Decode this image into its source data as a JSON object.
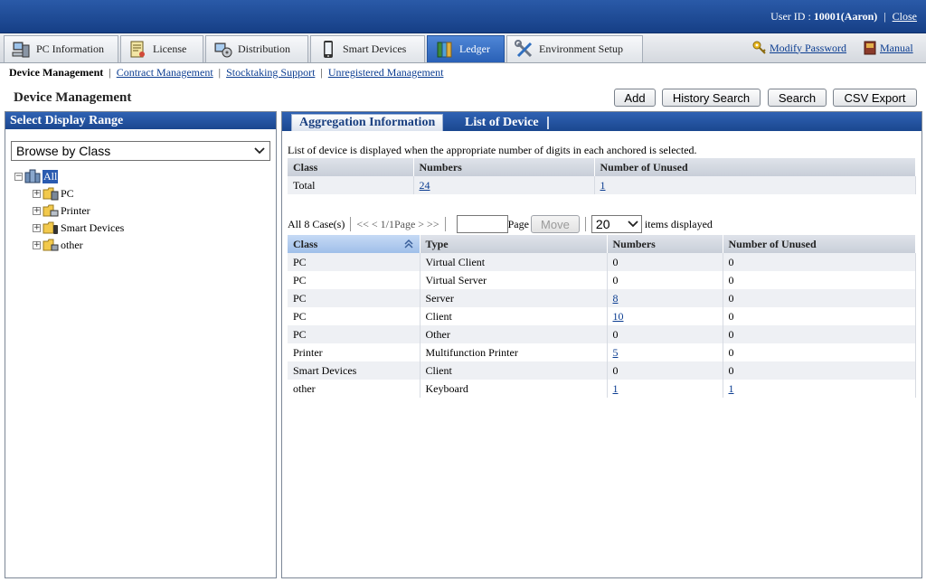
{
  "header": {
    "user_label": "User ID :",
    "user_value": "10001(Aaron)",
    "separator": "|",
    "close_label": "Close"
  },
  "nav": {
    "tabs": [
      {
        "label": "PC Information",
        "icon": "pc-icon"
      },
      {
        "label": "License",
        "icon": "license-icon"
      },
      {
        "label": "Distribution",
        "icon": "distribution-icon"
      },
      {
        "label": "Smart Devices",
        "icon": "smart-device-icon"
      },
      {
        "label": "Ledger",
        "icon": "ledger-icon",
        "active": true
      },
      {
        "label": "Environment Setup",
        "icon": "tools-icon"
      }
    ],
    "modify_password": "Modify Password",
    "manual": "Manual"
  },
  "subnav": {
    "items": [
      "Device Management",
      "Contract Management",
      "Stocktaking Support",
      "Unregistered Management"
    ],
    "separator": "|"
  },
  "page": {
    "title": "Device Management",
    "buttons": {
      "add": "Add",
      "history_search": "History Search",
      "search": "Search",
      "csv_export": "CSV Export"
    }
  },
  "left_panel": {
    "title": "Select Display Range",
    "browse_select": "Browse by Class",
    "tree": {
      "root": "All",
      "children": [
        "PC",
        "Printer",
        "Smart Devices",
        "other"
      ]
    }
  },
  "right_panel": {
    "tabs": [
      "Aggregation Information",
      "List of Device"
    ],
    "description": "List of device is displayed when the appropriate number of digits in each anchored is selected.",
    "summary": {
      "headers": [
        "Class",
        "Numbers",
        "Number of Unused"
      ],
      "row": {
        "class": "Total",
        "numbers": "24",
        "unused": "1"
      }
    },
    "pager": {
      "count": "All 8 Case(s)",
      "nav": "<< < 1/1Page > >>",
      "page_label": "Page",
      "move_label": "Move",
      "page_size": "20",
      "items_label": "items displayed"
    },
    "detail": {
      "headers": [
        "Class",
        "Type",
        "Numbers",
        "Number of Unused"
      ],
      "rows": [
        {
          "class": "PC",
          "type": "Virtual Client",
          "numbers": "0",
          "unused": "0"
        },
        {
          "class": "PC",
          "type": "Virtual Server",
          "numbers": "0",
          "unused": "0"
        },
        {
          "class": "PC",
          "type": "Server",
          "numbers": "8",
          "unused": "0"
        },
        {
          "class": "PC",
          "type": "Client",
          "numbers": "10",
          "unused": "0"
        },
        {
          "class": "PC",
          "type": "Other",
          "numbers": "0",
          "unused": "0"
        },
        {
          "class": "Printer",
          "type": "Multifunction Printer",
          "numbers": "5",
          "unused": "0"
        },
        {
          "class": "Smart Devices",
          "type": "Client",
          "numbers": "0",
          "unused": "0"
        },
        {
          "class": "other",
          "type": "Keyboard",
          "numbers": "1",
          "unused": "1"
        }
      ]
    }
  },
  "colors": {
    "header_blue": "#1b478f",
    "active_tab": "#2960b6",
    "link": "#0b3d91"
  }
}
